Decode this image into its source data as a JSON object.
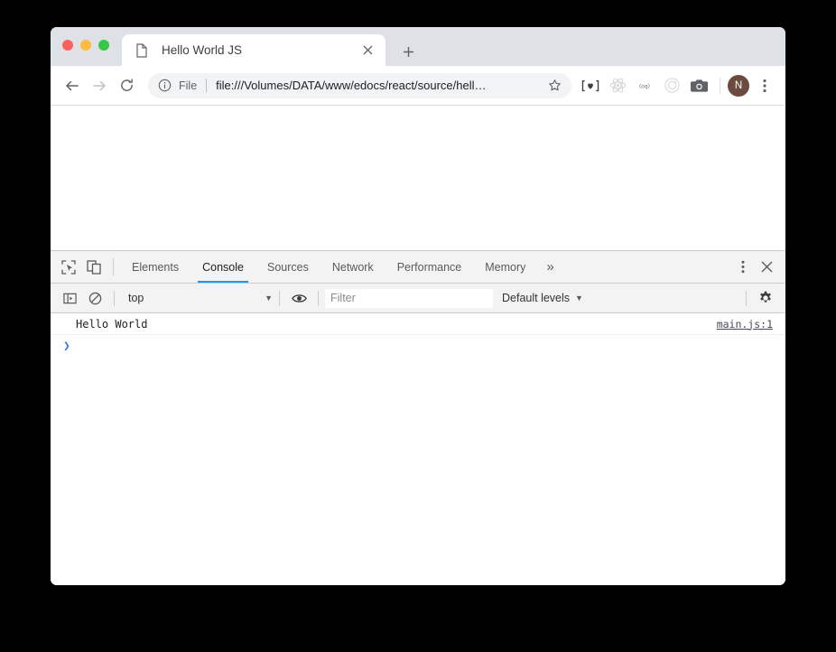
{
  "window": {
    "traffic_lights": [
      "close",
      "minimize",
      "maximize"
    ]
  },
  "tab": {
    "favicon": "page-icon",
    "title": "Hello World JS",
    "close_label": "×",
    "new_tab_label": "+"
  },
  "toolbar": {
    "back_icon": "back-arrow-icon",
    "forward_icon": "forward-arrow-icon",
    "reload_icon": "reload-icon",
    "security_icon": "info-circle-icon",
    "security_label": "File",
    "url": "file:///Volumes/DATA/www/edocs/react/source/hell…",
    "bookmark_icon": "star-icon",
    "extensions": [
      "bracket-heart-extension-icon",
      "react-devtools-icon",
      "text-badge-extension-icon",
      "spiral-extension-icon",
      "camera-extension-icon"
    ],
    "avatar_initial": "N",
    "menu_icon": "three-dot-menu-icon"
  },
  "devtools": {
    "inspect_icon": "inspect-element-icon",
    "device_icon": "device-toolbar-icon",
    "tabs": [
      {
        "label": "Elements",
        "active": false
      },
      {
        "label": "Console",
        "active": true
      },
      {
        "label": "Sources",
        "active": false
      },
      {
        "label": "Network",
        "active": false
      },
      {
        "label": "Performance",
        "active": false
      },
      {
        "label": "Memory",
        "active": false
      }
    ],
    "more_tabs_label": "»",
    "menu_icon": "three-dot-menu-icon",
    "close_icon": "close-icon",
    "active_tab_underline_color": "#1a9af5"
  },
  "console_filterbar": {
    "sidebar_icon": "console-sidebar-icon",
    "clear_icon": "clear-console-icon",
    "context": "top",
    "eye_icon": "live-expression-icon",
    "filter_placeholder": "Filter",
    "filter_value": "",
    "levels": "Default levels",
    "settings_icon": "gear-icon"
  },
  "console": {
    "messages": [
      {
        "text": "Hello World",
        "source": "main.js:1"
      }
    ],
    "prompt": "❯",
    "prompt_color": "#3b78e7"
  }
}
